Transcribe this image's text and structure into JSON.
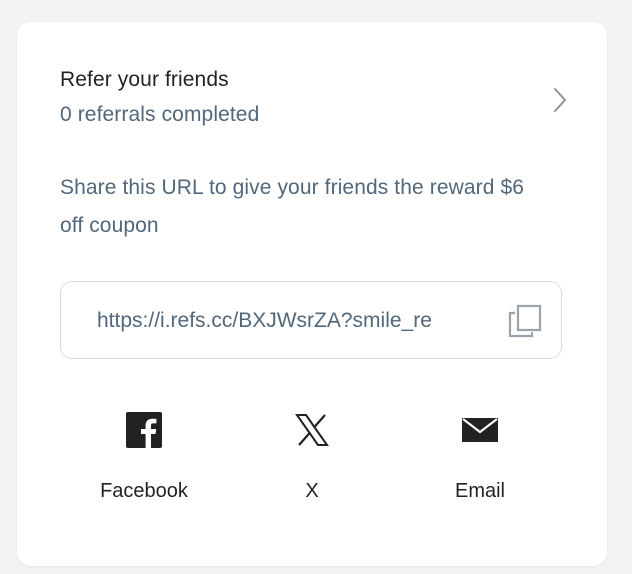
{
  "referral": {
    "title": "Refer your friends",
    "count_text": "0 referrals completed"
  },
  "share": {
    "description": "Share this URL to give your friends the reward $6 off coupon",
    "url": "https://i.refs.cc/BXJWsrZA?smile_re"
  },
  "share_options": [
    {
      "label": "Facebook",
      "icon": "facebook-icon"
    },
    {
      "label": "X",
      "icon": "x-icon"
    },
    {
      "label": "Email",
      "icon": "email-icon"
    }
  ],
  "colors": {
    "title_text": "#1f2327",
    "secondary_text": "#52677a",
    "border": "#d9dde1",
    "icon": "#222222"
  }
}
